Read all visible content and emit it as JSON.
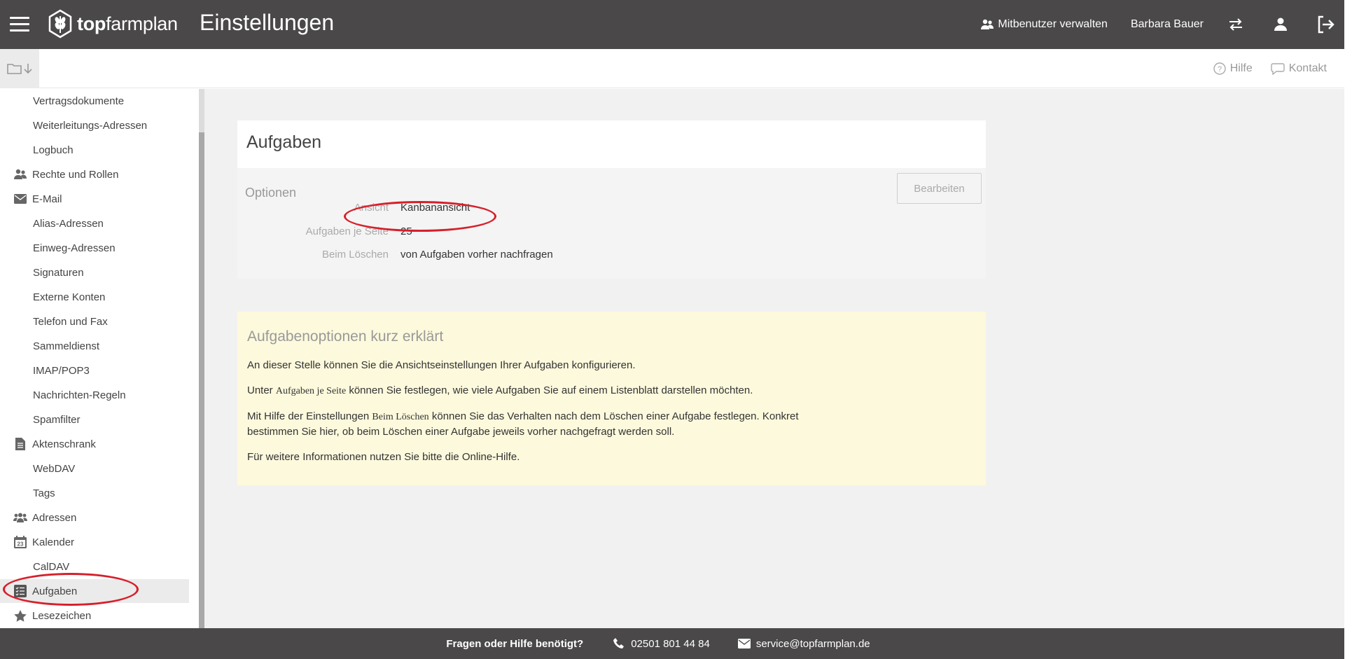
{
  "header": {
    "brand_prefix": "top",
    "brand_suffix": "farmplan",
    "page_title": "Einstellungen",
    "co_users_label": "Mitbenutzer verwalten",
    "user_name": "Barbara Bauer"
  },
  "subbar": {
    "help_label": "Hilfe",
    "contact_label": "Kontakt"
  },
  "sidebar": {
    "items": [
      {
        "label": "Vertragsdokumente",
        "level": "sub"
      },
      {
        "label": "Weiterleitungs-Adressen",
        "level": "sub"
      },
      {
        "label": "Logbuch",
        "level": "sub"
      },
      {
        "label": "Rechte und Rollen",
        "level": "top",
        "icon": "users-icon"
      },
      {
        "label": "E-Mail",
        "level": "top",
        "icon": "envelope-icon"
      },
      {
        "label": "Alias-Adressen",
        "level": "sub"
      },
      {
        "label": "Einweg-Adressen",
        "level": "sub"
      },
      {
        "label": "Signaturen",
        "level": "sub"
      },
      {
        "label": "Externe Konten",
        "level": "sub"
      },
      {
        "label": "Telefon und Fax",
        "level": "sub"
      },
      {
        "label": "Sammeldienst",
        "level": "sub"
      },
      {
        "label": "IMAP/POP3",
        "level": "sub"
      },
      {
        "label": "Nachrichten-Regeln",
        "level": "sub"
      },
      {
        "label": "Spamfilter",
        "level": "sub"
      },
      {
        "label": "Aktenschrank",
        "level": "top",
        "icon": "document-icon"
      },
      {
        "label": "WebDAV",
        "level": "sub"
      },
      {
        "label": "Tags",
        "level": "sub"
      },
      {
        "label": "Adressen",
        "level": "top",
        "icon": "people-icon"
      },
      {
        "label": "Kalender",
        "level": "top",
        "icon": "calendar-icon",
        "icon_text": "23"
      },
      {
        "label": "CalDAV",
        "level": "sub"
      },
      {
        "label": "Aufgaben",
        "level": "top",
        "icon": "tasks-icon",
        "active": true
      },
      {
        "label": "Lesezeichen",
        "level": "top",
        "icon": "star-icon"
      }
    ]
  },
  "main": {
    "card_title": "Aufgaben",
    "options_title": "Optionen",
    "edit_label": "Bearbeiten",
    "options": [
      {
        "label": "Ansicht",
        "value": "Kanbanansicht"
      },
      {
        "label": "Aufgaben je Seite",
        "value": "25"
      },
      {
        "label": "Beim Löschen",
        "value": "von Aufgaben vorher nachfragen"
      }
    ],
    "info": {
      "title": "Aufgabenoptionen kurz erklärt",
      "p1": "An dieser Stelle können Sie die Ansichtseinstellungen Ihrer Aufgaben konfigurieren.",
      "p2_a": "Unter ",
      "p2_term": "Aufgaben je Seite",
      "p2_b": " können Sie festlegen, wie viele Aufgaben Sie auf einem Listenblatt darstellen möchten.",
      "p3_a": "Mit Hilfe der Einstellungen ",
      "p3_term": "Beim Löschen",
      "p3_b": " können Sie das Verhalten nach dem Löschen einer Aufgabe festlegen. Konkret bestimmen Sie hier, ob beim Löschen einer Aufgabe jeweils vorher nachgefragt werden soll.",
      "p4": "Für weitere Informationen nutzen Sie bitte die Online-Hilfe."
    }
  },
  "footer": {
    "question": "Fragen oder Hilfe benötigt?",
    "phone": "02501 801 44 84",
    "email": "service@topfarmplan.de"
  },
  "colors": {
    "topbar": "#4a4848",
    "info_bg": "#fdf9dc",
    "annotation": "#d6202b"
  }
}
